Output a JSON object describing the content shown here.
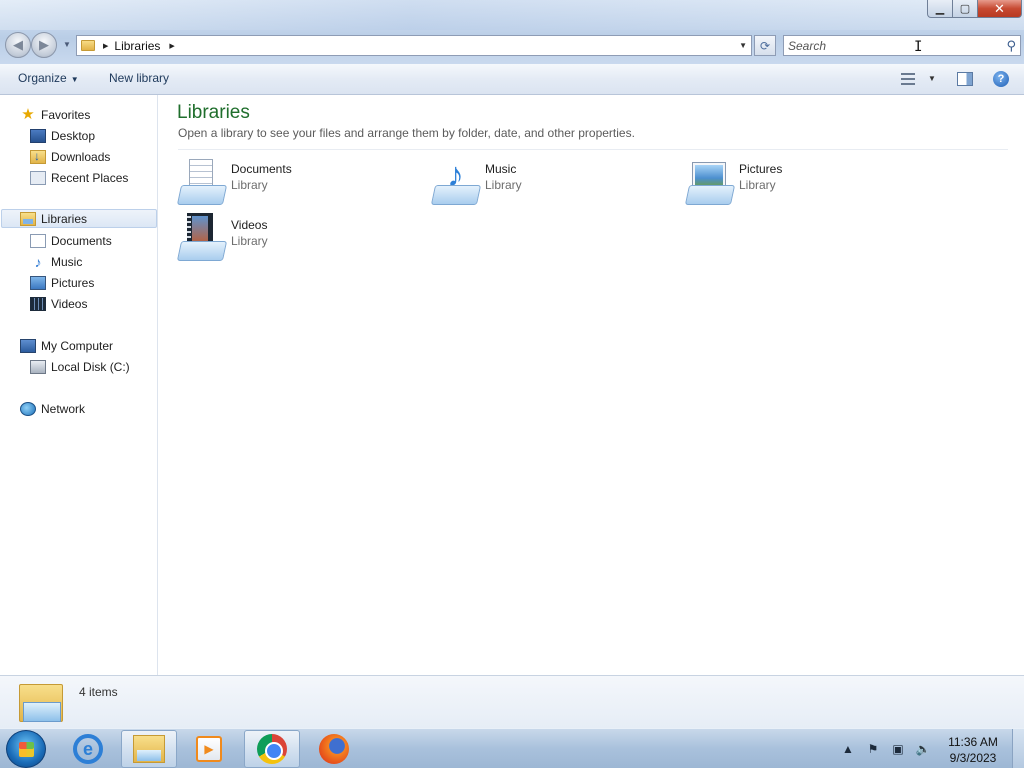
{
  "window": {
    "caption": {
      "minimize": "▁",
      "maximize": "▢",
      "close": "✕"
    }
  },
  "address": {
    "breadcrumb": "Libraries",
    "search_placeholder": "Search"
  },
  "commandbar": {
    "organize": "Organize",
    "new_library": "New library"
  },
  "navpane": {
    "favorites": {
      "label": "Favorites",
      "icon": "star-icon",
      "items": [
        {
          "label": "Desktop",
          "icon": "desktop-icon"
        },
        {
          "label": "Downloads",
          "icon": "downloads-folder-icon"
        },
        {
          "label": "Recent Places",
          "icon": "recent-places-icon"
        }
      ]
    },
    "libraries": {
      "label": "Libraries",
      "icon": "libraries-icon",
      "selected": true,
      "items": [
        {
          "label": "Documents",
          "icon": "documents-icon"
        },
        {
          "label": "Music",
          "icon": "music-icon"
        },
        {
          "label": "Pictures",
          "icon": "pictures-icon"
        },
        {
          "label": "Videos",
          "icon": "videos-icon"
        }
      ]
    },
    "computer": {
      "label": "My Computer",
      "icon": "computer-icon",
      "items": [
        {
          "label": "Local Disk (C:)",
          "icon": "disk-icon"
        }
      ]
    },
    "network": {
      "label": "Network",
      "icon": "network-icon"
    }
  },
  "content": {
    "title": "Libraries",
    "subtitle": "Open a library to see your files and arrange them by folder, date, and other properties.",
    "libraries": [
      {
        "name": "Documents",
        "type": "Library",
        "icon": "documents-library-icon"
      },
      {
        "name": "Music",
        "type": "Library",
        "icon": "music-library-icon"
      },
      {
        "name": "Pictures",
        "type": "Library",
        "icon": "pictures-library-icon"
      },
      {
        "name": "Videos",
        "type": "Library",
        "icon": "videos-library-icon"
      }
    ]
  },
  "details": {
    "count": "4 items"
  },
  "taskbar": {
    "apps": [
      "internet-explorer-icon",
      "windows-explorer-icon",
      "media-player-icon",
      "chrome-icon",
      "firefox-icon"
    ],
    "active_app": "windows-explorer-icon",
    "clock_time": "11:36 AM",
    "clock_date": "9/3/2023"
  },
  "colors": {
    "title_green": "#1f6e2c",
    "command_text": "#1e395b",
    "close_red": "#c74a32"
  }
}
